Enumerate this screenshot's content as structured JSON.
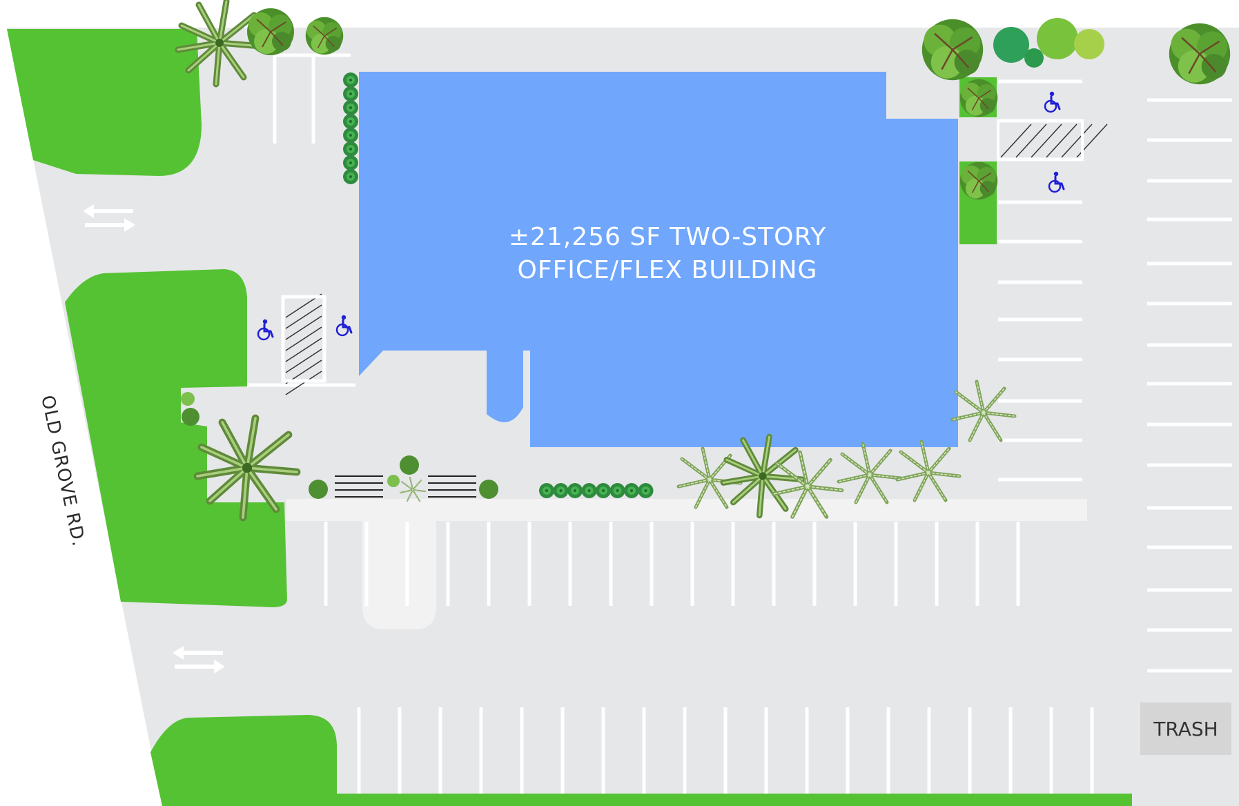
{
  "building": {
    "line1": "±21,256 SF TWO-STORY",
    "line2": "OFFICE/FLEX BUILDING"
  },
  "street": {
    "name": "OLD GROVE RD."
  },
  "trash": {
    "label": "TRASH"
  },
  "colors": {
    "pavement": "#e6e7e9",
    "landscape": "#55c234",
    "building": "#70a7fc",
    "sidewalk": "#f2f2f2",
    "stripe": "#ffffff",
    "accessible_icon": "#1f1fd6",
    "trash_pad": "#d5d5d5"
  },
  "icons": {
    "accessible": "wheelchair-icon",
    "traffic_flow": "two-way-arrow-icon",
    "tree": "tree-icon",
    "palm": "palm-icon",
    "shrub": "shrub-icon"
  }
}
